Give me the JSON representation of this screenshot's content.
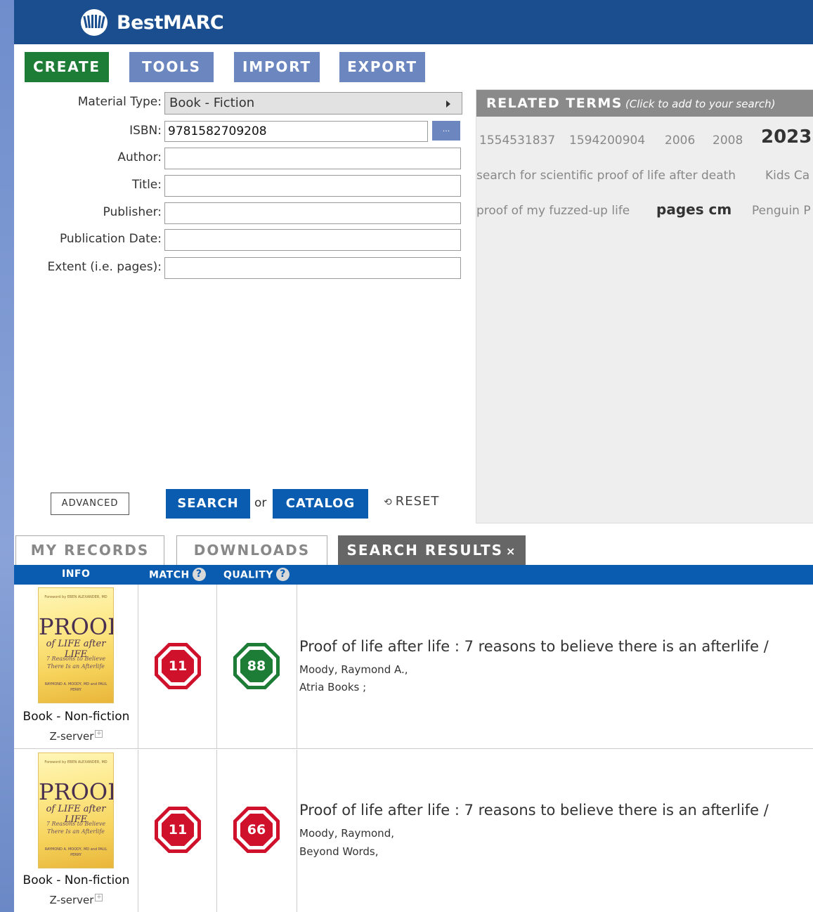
{
  "app": {
    "name": "BestMARC"
  },
  "nav": {
    "create": "CREATE",
    "tools": "TOOLS",
    "import": "IMPORT",
    "export": "EXPORT"
  },
  "form": {
    "material_type_label": "Material Type:",
    "material_type_value": "Book - Fiction",
    "isbn_label": "ISBN:",
    "isbn_value": "9781582709208",
    "isbn_lookup": "...",
    "author_label": "Author:",
    "title_label": "Title:",
    "publisher_label": "Publisher:",
    "pubdate_label": "Publication Date:",
    "extent_label": "Extent (i.e. pages):"
  },
  "actions": {
    "advanced": "ADVANCED",
    "search": "SEARCH",
    "or": "or",
    "catalog": "CATALOG",
    "reset": "RESET"
  },
  "related": {
    "header": "RELATED TERMS",
    "hint": "(Click to add to your search)",
    "terms": [
      "1554531837",
      "1594200904",
      "2006",
      "2008",
      "2023",
      "search for scientific proof of life after death",
      "Kids Ca",
      "proof of my fuzzed-up life",
      "pages cm",
      "Penguin P"
    ]
  },
  "tabs": {
    "my_records": "MY RECORDS",
    "downloads": "DOWNLOADS",
    "search_results": "SEARCH RESULTS",
    "close": "×"
  },
  "columns": {
    "info": "INFO",
    "match": "MATCH",
    "quality": "QUALITY",
    "help": "?"
  },
  "results": [
    {
      "material": "Book - Non-fiction",
      "source": "Z-server",
      "match": "11",
      "quality": "88",
      "title": "Proof of life after life : 7 reasons to believe there is an afterlife /",
      "author": "Moody, Raymond A.,",
      "publisher": "Atria Books ;"
    },
    {
      "material": "Book - Non-fiction",
      "source": "Z-server",
      "match": "11",
      "quality": "66",
      "title": "Proof of life after life : 7 reasons to believe there is an afterlife /",
      "author": "Moody, Raymond,",
      "publisher": "Beyond Words,"
    }
  ],
  "cover": {
    "top": "Foreword by EBEN ALEXANDER, MD",
    "title": "PROOF",
    "subtitle": "of LIFE after LIFE",
    "tagline": "7 Reasons to Believe There Is an Afterlife",
    "authors": "RAYMOND A. MOODY, MD and PAUL PERRY"
  },
  "colors": {
    "header": "#1b4e8e",
    "create": "#1d7d36",
    "nav": "#6c86c0",
    "primary": "#0a5cb0",
    "match_red": "#d0112b",
    "quality_green": "#1d7d36"
  }
}
